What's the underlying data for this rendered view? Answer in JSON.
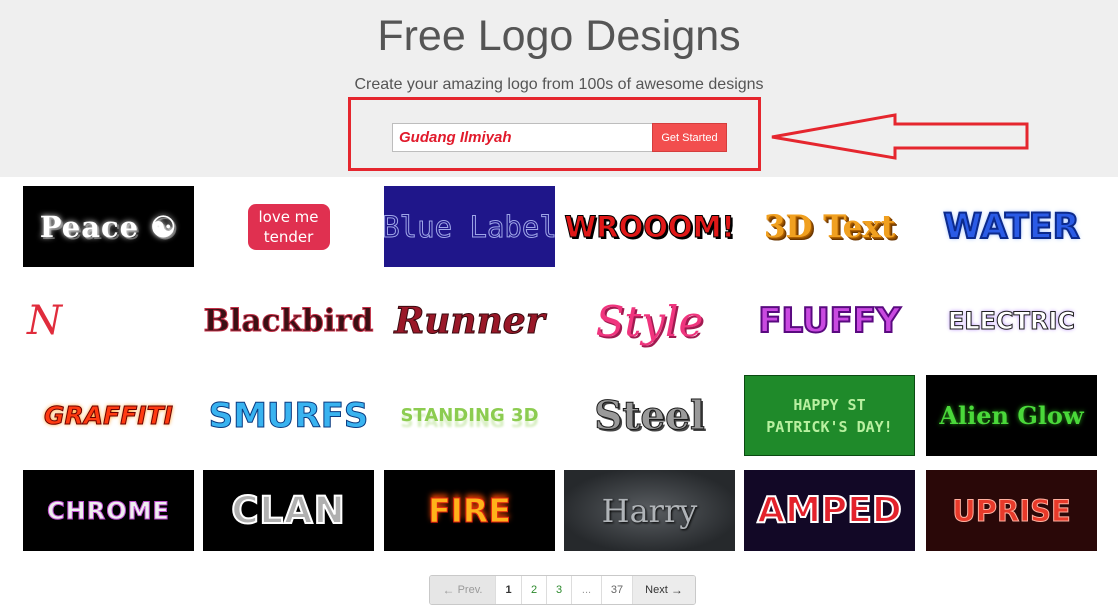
{
  "header": {
    "title": "Free Logo Designs",
    "subtitle": "Create your amazing logo from 100s of awesome designs"
  },
  "form": {
    "input_value": "Gudang Ilmiyah",
    "button_label": "Get Started"
  },
  "colors": {
    "annotation": "#e5262e",
    "button": "#f24e4e",
    "header_bg": "#efefef"
  },
  "logos": [
    [
      "Peace ☯",
      "love me tender",
      "Blue Label",
      "WROOOM!",
      "3D Text",
      "WATER"
    ],
    [
      "N",
      "Blackbird",
      "Runner",
      "Style",
      "FLUFFY",
      "ELECTRIC"
    ],
    [
      "GRAFFITI",
      "SMURFS",
      "STANDING 3D",
      "Steel",
      "HAPPY ST PATRICK'S DAY!",
      "Alien Glow"
    ],
    [
      "CHROME",
      "CLAN",
      "FIRE",
      "Harry",
      "AMPED",
      "UPRISE"
    ]
  ],
  "pagination": {
    "prev": "Prev.",
    "pages": [
      "1",
      "2",
      "3",
      "...",
      "37"
    ],
    "next": "Next",
    "prev_icon": "arrow-left-icon",
    "next_icon": "arrow-right-icon"
  }
}
